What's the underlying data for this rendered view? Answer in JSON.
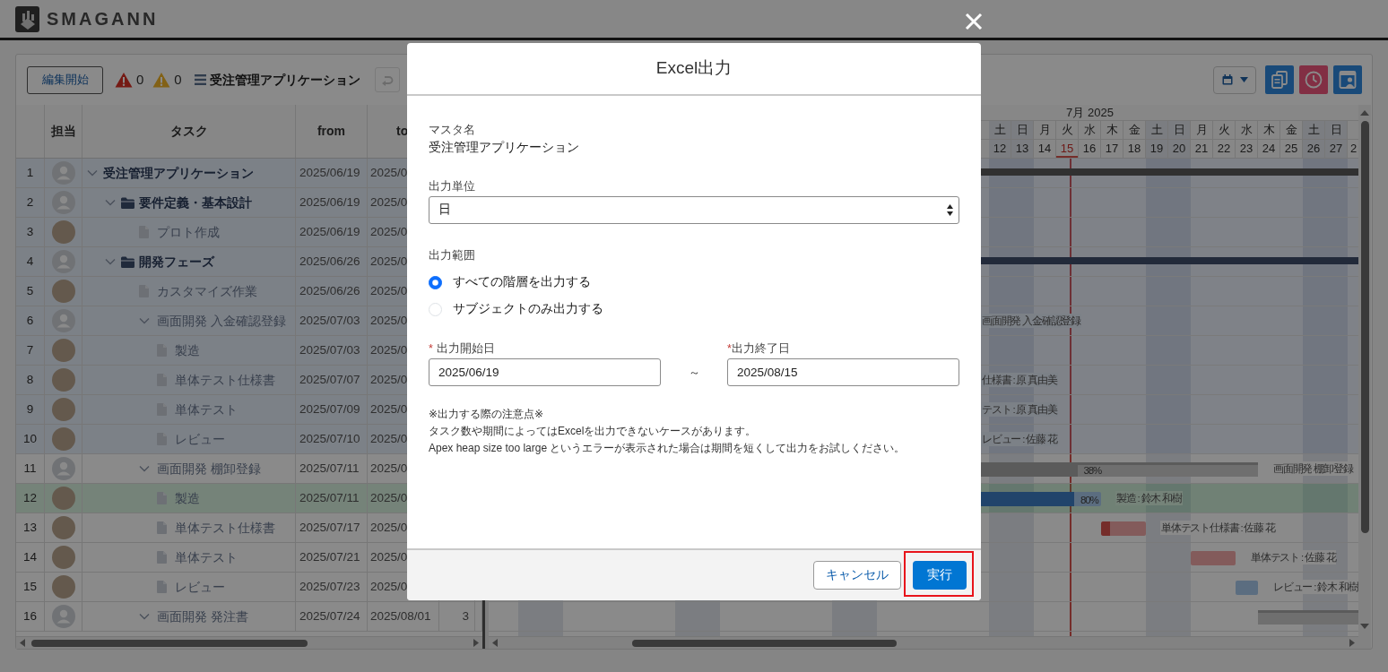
{
  "app": {
    "logo_text": "SMAGANN"
  },
  "toolbar": {
    "edit_button": "編集開始",
    "errors": "0",
    "warnings": "0",
    "project_name": "受注管理アプリケーション",
    "undo_disabled": true,
    "action_buttons": [
      {
        "kind": "copy"
      },
      {
        "kind": "history"
      },
      {
        "kind": "profile"
      }
    ]
  },
  "columns": [
    "担当",
    "タスク",
    "from",
    "to"
  ],
  "rows": [
    {
      "no": "1",
      "has_photo": false,
      "kind": "project",
      "name": "受注管理アプリケーション",
      "expanded": true,
      "from": "2025/06/19",
      "to": "2025/0",
      "highlighted": true,
      "selected": false,
      "gantt": {
        "kind": "project"
      },
      "children": [
        {
          "no": "2",
          "has_photo": false,
          "kind": "phase",
          "name": "要件定義・基本設計",
          "expanded": true,
          "from": "2025/06/19",
          "to": "2025/0",
          "highlighted": true,
          "selected": false,
          "children": [
            {
              "no": "3",
              "has_photo": true,
              "kind": "task",
              "name": "プロト作成",
              "from": "2025/06/19",
              "to": "2025/0",
              "highlighted": true,
              "selected": false
            }
          ]
        },
        {
          "no": "4",
          "has_photo": false,
          "kind": "phase",
          "name": "開発フェーズ",
          "expanded": true,
          "from": "2025/06/26",
          "to": "2025/0",
          "highlighted": true,
          "selected": false,
          "gantt": {
            "kind": "phase"
          },
          "children": [
            {
              "no": "5",
              "has_photo": true,
              "kind": "task",
              "name": "カスタマイズ作業",
              "from": "2025/06/26",
              "to": "2025/0",
              "highlighted": true,
              "selected": false
            },
            {
              "no": "6",
              "has_photo": false,
              "kind": "group",
              "name": "画面開発 入金確認登録",
              "expanded": true,
              "from": "2025/07/03",
              "to": "2025/0",
              "highlighted": true,
              "selected": false,
              "gantt": {
                "label": "画面開発 入金確認登録"
              },
              "children": [
                {
                  "no": "7",
                  "has_photo": true,
                  "kind": "task",
                  "name": "製造",
                  "from": "2025/07/03",
                  "to": "2025/0",
                  "highlighted": true,
                  "selected": false
                },
                {
                  "no": "8",
                  "has_photo": true,
                  "kind": "task",
                  "name": "単体テスト仕様書",
                  "from": "2025/07/07",
                  "to": "2025/0",
                  "highlighted": true,
                  "selected": false,
                  "gantt": {
                    "label": "仕様書 : 原 真由美"
                  }
                },
                {
                  "no": "9",
                  "has_photo": true,
                  "kind": "task",
                  "name": "単体テスト",
                  "from": "2025/07/09",
                  "to": "2025/0",
                  "highlighted": true,
                  "selected": false,
                  "gantt": {
                    "label": "テスト : 原 真由美"
                  }
                },
                {
                  "no": "10",
                  "has_photo": true,
                  "kind": "task",
                  "name": "レビュー",
                  "from": "2025/07/10",
                  "to": "2025/0",
                  "highlighted": true,
                  "selected": false,
                  "gantt": {
                    "label": "レビュー : 佐藤 花"
                  }
                }
              ]
            },
            {
              "no": "11",
              "has_photo": false,
              "kind": "group",
              "name": "画面開発 棚卸登録",
              "expanded": true,
              "from": "2025/07/11",
              "to": "2025/0",
              "highlighted": false,
              "selected": false,
              "gantt": {
                "kind": "group",
                "level": 0.38,
                "progress_label": "38%",
                "label": "画面開発 棚卸登録"
              },
              "children": [
                {
                  "no": "12",
                  "has_photo": true,
                  "kind": "task",
                  "name": "製造",
                  "from": "2025/07/11",
                  "to": "2025/0",
                  "highlighted": false,
                  "selected": true,
                  "gantt": {
                    "kind": "task",
                    "late": false,
                    "level": 0.8,
                    "progress_label": "80%",
                    "label": "製造 : 鈴木 和樹"
                  }
                },
                {
                  "no": "13",
                  "has_photo": true,
                  "kind": "task",
                  "name": "単体テスト仕様書",
                  "from": "2025/07/17",
                  "to": "2025/0",
                  "highlighted": false,
                  "selected": false,
                  "gantt": {
                    "kind": "task",
                    "late": true,
                    "level": 0.2,
                    "label": "単体テスト仕様書 : 佐藤 花"
                  }
                },
                {
                  "no": "14",
                  "has_photo": true,
                  "kind": "task",
                  "name": "単体テスト",
                  "from": "2025/07/21",
                  "to": "2025/0",
                  "highlighted": false,
                  "selected": false,
                  "gantt": {
                    "kind": "task",
                    "late": true,
                    "label": "単体テスト : 佐藤 花"
                  }
                },
                {
                  "no": "15",
                  "has_photo": true,
                  "kind": "task",
                  "name": "レビュー",
                  "from": "2025/07/23",
                  "to": "2025/0",
                  "highlighted": false,
                  "selected": false,
                  "gantt": {
                    "kind": "task",
                    "late": false,
                    "label": "レビュー : 鈴木 和樹"
                  }
                }
              ]
            },
            {
              "no": "16",
              "has_photo": false,
              "kind": "group",
              "name": "画面開発 発注書",
              "expanded": true,
              "from": "2025/07/24",
              "to": "2025/08/01",
              "column_6": "3",
              "highlighted": false,
              "selected": false,
              "gantt": {
                "kind": "group"
              }
            }
          ]
        }
      ]
    }
  ],
  "gantt": {
    "month": "7月 2025",
    "days": [
      {
        "weekday": "土",
        "day": "12",
        "weekend": true,
        "today": false
      },
      {
        "weekday": "日",
        "day": "13",
        "weekend": true,
        "today": false
      },
      {
        "weekday": "月",
        "day": "14",
        "weekend": false,
        "today": false
      },
      {
        "weekday": "火",
        "day": "15",
        "weekend": false,
        "today": true
      },
      {
        "weekday": "水",
        "day": "16",
        "weekend": false,
        "today": false
      },
      {
        "weekday": "木",
        "day": "17",
        "weekend": false,
        "today": false
      },
      {
        "weekday": "金",
        "day": "18",
        "weekend": false,
        "today": false
      },
      {
        "weekday": "土",
        "day": "19",
        "weekend": true,
        "today": false
      },
      {
        "weekday": "日",
        "day": "20",
        "weekend": true,
        "today": false
      },
      {
        "weekday": "月",
        "day": "21",
        "weekend": false,
        "today": false
      },
      {
        "weekday": "火",
        "day": "22",
        "weekend": false,
        "today": false
      },
      {
        "weekday": "水",
        "day": "23",
        "weekend": false,
        "today": false
      },
      {
        "weekday": "木",
        "day": "24",
        "weekend": false,
        "today": false
      },
      {
        "weekday": "金",
        "day": "25",
        "weekend": false,
        "today": false
      },
      {
        "weekday": "土",
        "day": "26",
        "weekend": true,
        "today": false
      },
      {
        "weekday": "日",
        "day": "27",
        "weekend": true,
        "today": false
      },
      {
        "day": "2",
        "weekend": false,
        "today": false
      }
    ]
  },
  "dialog": {
    "title": "Excel出力",
    "master": {
      "label": "マスタ名",
      "value": "受注管理アプリケーション"
    },
    "unit": {
      "label": "出力単位",
      "value": "日"
    },
    "range": {
      "label": "出力範囲",
      "options": [
        {
          "label": "すべての階層を出力する",
          "selected": true
        },
        {
          "label": "サブジェクトのみ出力する",
          "selected": false
        }
      ]
    },
    "start": {
      "marker": "*",
      "label": "出力開始日",
      "value": "2025/06/19"
    },
    "separator": "～",
    "end": {
      "marker": "*",
      "label": "出力終了日",
      "value": "2025/08/15"
    },
    "notes": [
      "※出力する際の注意点※",
      "タスク数や期間によってはExcelを出力できないケースがあります。",
      "Apex heap size too large というエラーが表示された場合は期間を短くして出力をお試しください。"
    ],
    "cancel": "キャンセル",
    "run": {
      "label": "実行",
      "highlighted": true
    }
  }
}
